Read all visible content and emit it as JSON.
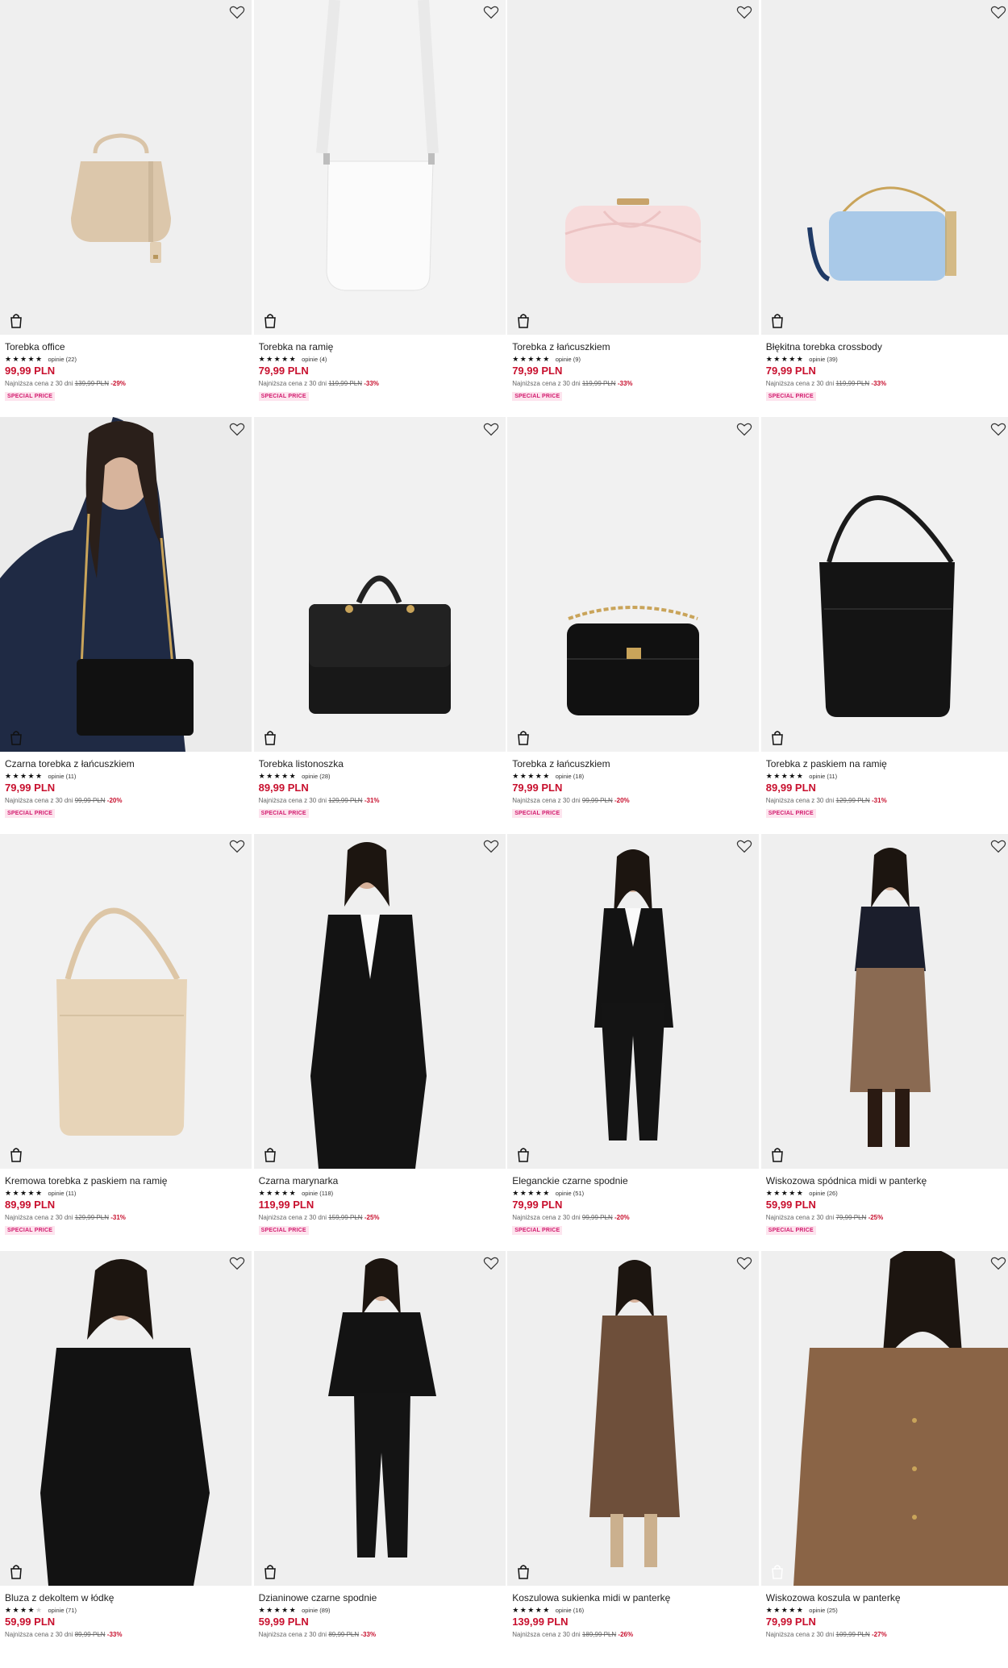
{
  "labels": {
    "lowest_prefix": "Najniższa cena z 30 dni",
    "reviews_prefix": "opinie"
  },
  "colors": {
    "price": "#c8102e",
    "badge_bg": "#fde4ee",
    "badge_text": "#d21b6e"
  },
  "products": [
    {
      "name": "Torebka office",
      "stars": 4.5,
      "reviews": "opinie (22)",
      "price": "99,99 PLN",
      "old_price": "139,99 PLN",
      "discount": "-29%",
      "badge": "SPECIAL PRICE",
      "icon": "beige-handbag"
    },
    {
      "name": "Torebka na ramię",
      "stars": 5,
      "reviews": "opinie (4)",
      "price": "79,99 PLN",
      "old_price": "119,99 PLN",
      "discount": "-33%",
      "badge": "SPECIAL PRICE",
      "icon": "white-shoulder-bag"
    },
    {
      "name": "Torebka z łańcuszkiem",
      "stars": 5,
      "reviews": "opinie (9)",
      "price": "79,99 PLN",
      "old_price": "119,99 PLN",
      "discount": "-33%",
      "badge": "SPECIAL PRICE",
      "icon": "pink-clutch"
    },
    {
      "name": "Błękitna torebka crossbody",
      "stars": 5,
      "reviews": "opinie (39)",
      "price": "79,99 PLN",
      "old_price": "119,99 PLN",
      "discount": "-33%",
      "badge": "SPECIAL PRICE",
      "icon": "blue-crossbody"
    },
    {
      "name": "Czarna torebka z łańcuszkiem",
      "stars": 4.5,
      "reviews": "opinie (11)",
      "price": "79,99 PLN",
      "old_price": "99,99 PLN",
      "discount": "-20%",
      "badge": "SPECIAL PRICE",
      "icon": "model-black-bag"
    },
    {
      "name": "Torebka listonoszka",
      "stars": 5,
      "reviews": "opinie (28)",
      "price": "89,99 PLN",
      "old_price": "129,99 PLN",
      "discount": "-31%",
      "badge": "SPECIAL PRICE",
      "icon": "black-messenger"
    },
    {
      "name": "Torebka z łańcuszkiem",
      "stars": 4.5,
      "reviews": "opinie (18)",
      "price": "79,99 PLN",
      "old_price": "99,99 PLN",
      "discount": "-20%",
      "badge": "SPECIAL PRICE",
      "icon": "black-quilted-bag"
    },
    {
      "name": "Torebka z paskiem na ramię",
      "stars": 5,
      "reviews": "opinie (11)",
      "price": "89,99 PLN",
      "old_price": "129,99 PLN",
      "discount": "-31%",
      "badge": "SPECIAL PRICE",
      "icon": "black-bucket-bag"
    },
    {
      "name": "Kremowa torebka z paskiem na ramię",
      "stars": 5,
      "reviews": "opinie (11)",
      "price": "89,99 PLN",
      "old_price": "129,99 PLN",
      "discount": "-31%",
      "badge": "SPECIAL PRICE",
      "icon": "cream-bucket-bag"
    },
    {
      "name": "Czarna marynarka",
      "stars": 4.5,
      "reviews": "opinie (118)",
      "price": "119,99 PLN",
      "old_price": "159,99 PLN",
      "discount": "-25%",
      "badge": "SPECIAL PRICE",
      "icon": "model-black-blazer"
    },
    {
      "name": "Eleganckie czarne spodnie",
      "stars": 4.5,
      "reviews": "opinie (51)",
      "price": "79,99 PLN",
      "old_price": "99,99 PLN",
      "discount": "-20%",
      "badge": "SPECIAL PRICE",
      "icon": "model-black-suit"
    },
    {
      "name": "Wiskozowa spódnica midi w panterkę",
      "stars": 4.5,
      "reviews": "opinie (26)",
      "price": "59,99 PLN",
      "old_price": "79,99 PLN",
      "discount": "-25%",
      "badge": "SPECIAL PRICE",
      "icon": "model-leopard-skirt"
    },
    {
      "name": "Bluza z dekoltem w łódkę",
      "stars": 4,
      "reviews": "opinie (71)",
      "price": "59,99 PLN",
      "old_price": "89,99 PLN",
      "discount": "-33%",
      "badge": "",
      "icon": "model-black-top"
    },
    {
      "name": "Dzianinowe czarne spodnie",
      "stars": 4.5,
      "reviews": "opinie (89)",
      "price": "59,99 PLN",
      "old_price": "89,99 PLN",
      "discount": "-33%",
      "badge": "",
      "icon": "model-knit-set"
    },
    {
      "name": "Koszulowa sukienka midi w panterkę",
      "stars": 4.5,
      "reviews": "opinie (16)",
      "price": "139,99 PLN",
      "old_price": "189,99 PLN",
      "discount": "-26%",
      "badge": "",
      "icon": "model-leopard-dress"
    },
    {
      "name": "Wiskozowa koszula w panterkę",
      "stars": 5,
      "reviews": "opinie (25)",
      "price": "79,99 PLN",
      "old_price": "109,99 PLN",
      "discount": "-27%",
      "badge": "",
      "icon": "model-leopard-shirt"
    }
  ]
}
